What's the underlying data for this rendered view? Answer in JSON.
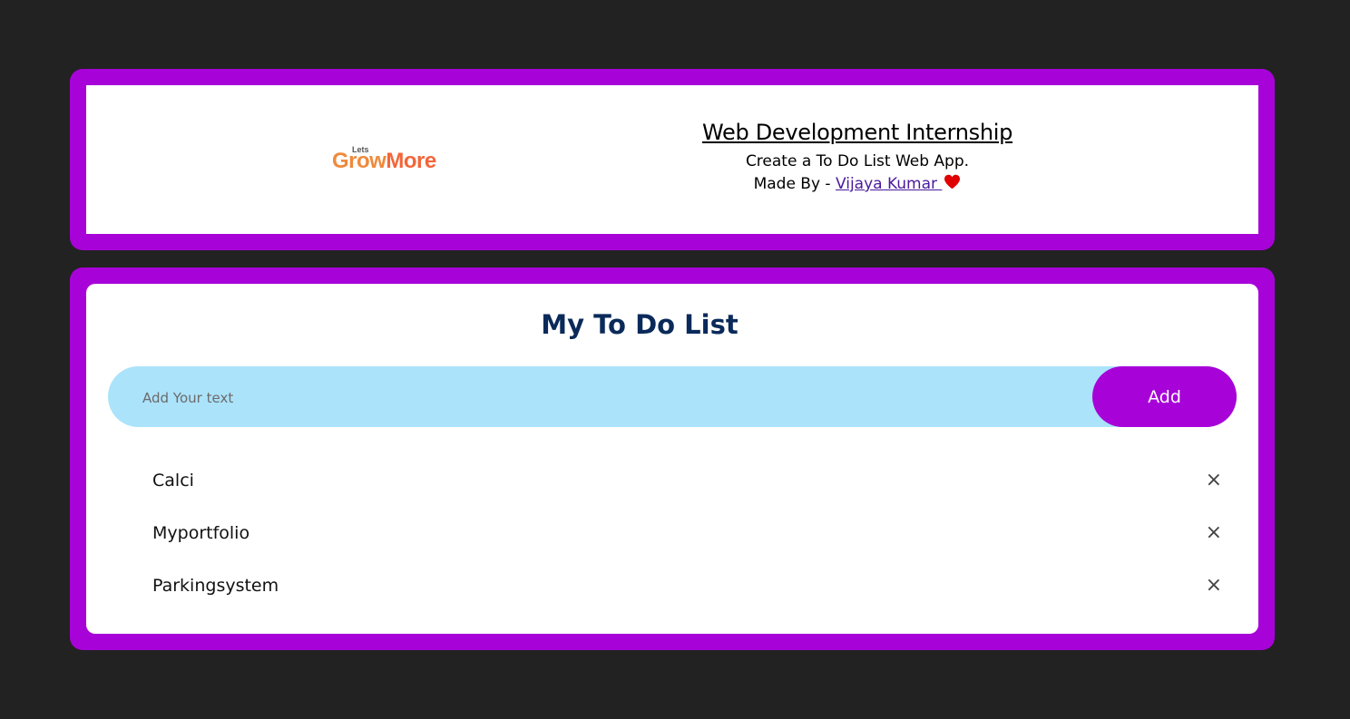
{
  "header": {
    "logo_lets": "Lets",
    "logo_grow": "Grow",
    "logo_more": "More",
    "title": "Web Development Internship",
    "subtitle": "Create a To Do List Web App.",
    "made_by_prefix": "Made By - ",
    "author": "Vijaya Kumar "
  },
  "todo": {
    "title": "My To Do List",
    "input_placeholder": "Add Your text",
    "add_label": "Add",
    "items": [
      {
        "text": "Calci",
        "remove_icon": "×"
      },
      {
        "text": "Myportfolio",
        "remove_icon": "×"
      },
      {
        "text": "Parkingsystem",
        "remove_icon": "×"
      }
    ]
  },
  "colors": {
    "background": "#222222",
    "accent": "#a703d8",
    "input_bg": "#abe3fb",
    "title": "#0a2a5a",
    "heart": "#e00000"
  }
}
